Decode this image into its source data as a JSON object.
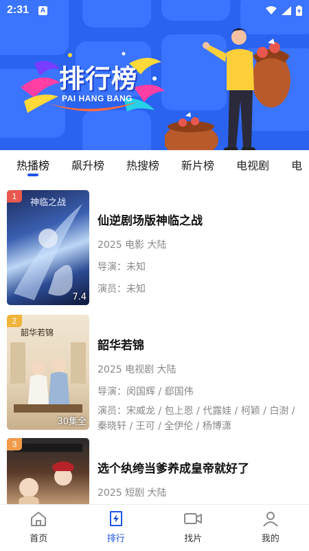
{
  "status_bar": {
    "time": "2:31",
    "badge": "A"
  },
  "banner": {
    "title": "排行榜",
    "subtitle": "PAI HANG BANG"
  },
  "tabs": [
    {
      "label": "热播榜",
      "active": true
    },
    {
      "label": "飙升榜",
      "active": false
    },
    {
      "label": "热搜榜",
      "active": false
    },
    {
      "label": "新片榜",
      "active": false
    },
    {
      "label": "电视剧",
      "active": false
    },
    {
      "label": "电",
      "active": false
    }
  ],
  "items": [
    {
      "rank": "1",
      "title": "仙逆剧场版神临之战",
      "meta": "2025 电影 大陆",
      "director": "导演：未知",
      "cast": "演员：未知",
      "poster_corner": "7.4"
    },
    {
      "rank": "2",
      "title": "韶华若锦",
      "meta": "2025 电视剧 大陆",
      "director": "导演：闵国辉 / 郄国伟",
      "cast": "演员：宋威龙 / 包上恩 / 代露娃 / 柯颖 / 白澍 / 秦晓轩 / 王可 / 全伊伦 / 杨博潇",
      "poster_corner": "30集全"
    },
    {
      "rank": "3",
      "title": "选个纨绔当爹养成皇帝就好了",
      "meta": "2025 短剧 大陆",
      "director": "",
      "cast": "",
      "poster_corner": ""
    }
  ],
  "bottom_nav": [
    {
      "label": "首页",
      "icon": "home-icon",
      "active": false
    },
    {
      "label": "排行",
      "icon": "ranking-icon",
      "active": true
    },
    {
      "label": "找片",
      "icon": "video-camera-icon",
      "active": false
    },
    {
      "label": "我的",
      "icon": "profile-icon",
      "active": false
    }
  ],
  "colors": {
    "banner_blue": "#2a63ef",
    "accent": "#1d55e6",
    "rank1": "#e8584f",
    "rank2": "#f0b43a",
    "rank3": "#f39a4a"
  }
}
